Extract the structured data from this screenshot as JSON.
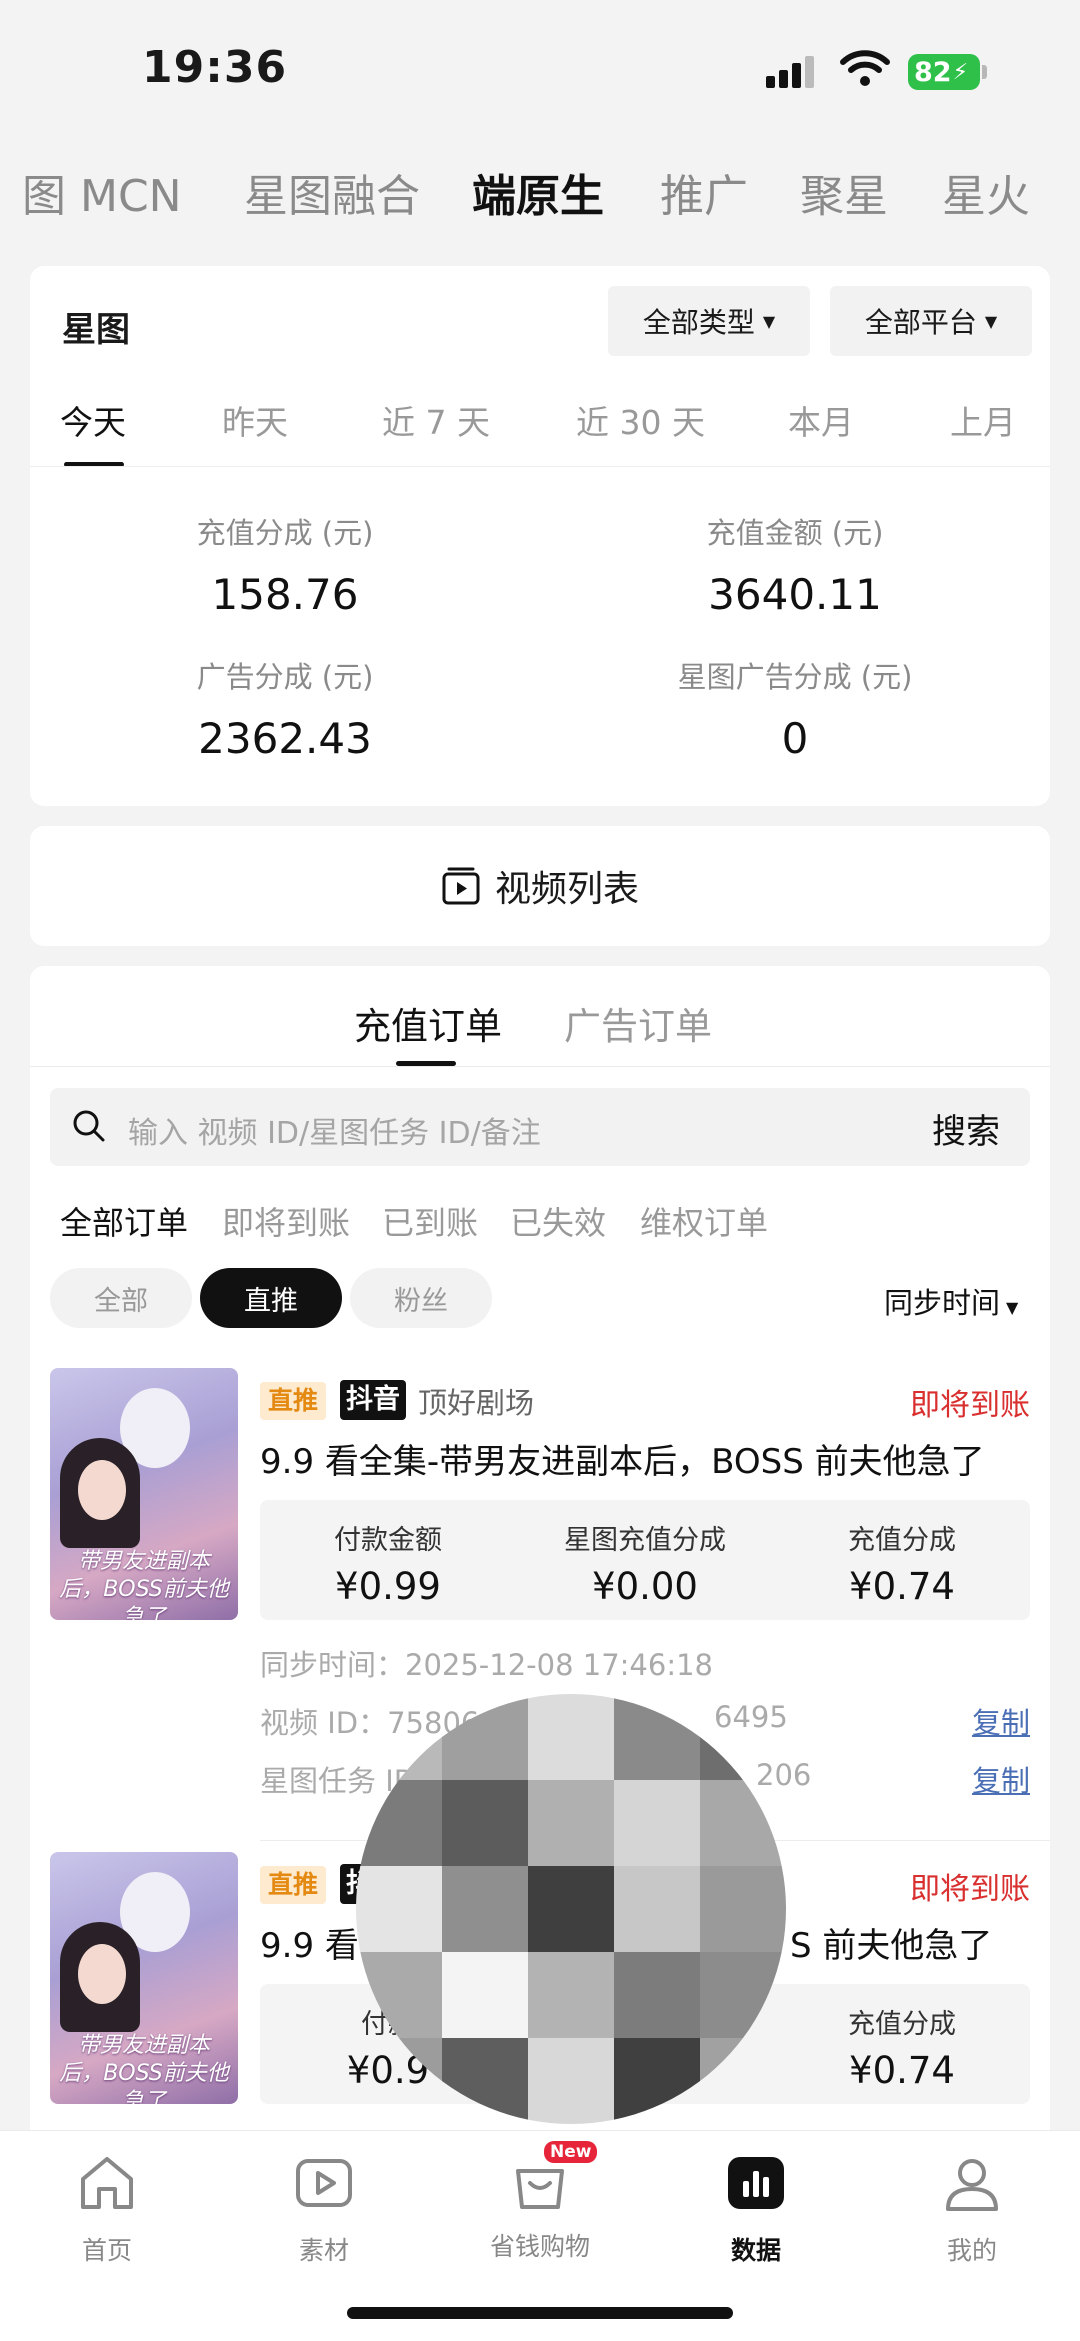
{
  "status_bar": {
    "time": "19:36",
    "battery": "82"
  },
  "category_tabs": [
    "图 MCN",
    "星图融合",
    "端原生",
    "推广",
    "聚星",
    "星火"
  ],
  "stats": {
    "title": "星图",
    "type_filter": "全部类型",
    "platform_filter": "全部平台",
    "date_tabs": [
      "今天",
      "昨天",
      "近 7 天",
      "近 30 天",
      "本月",
      "上月"
    ],
    "metrics": [
      {
        "label": "充值分成 (元)",
        "value": "158.76"
      },
      {
        "label": "充值金额 (元)",
        "value": "3640.11"
      },
      {
        "label": "广告分成 (元)",
        "value": "2362.43"
      },
      {
        "label": "星图广告分成 (元)",
        "value": "0"
      }
    ]
  },
  "video_list": {
    "label": "视频列表"
  },
  "orders": {
    "tab_recharge": "充值订单",
    "tab_ads": "广告订单",
    "search_placeholder": "输入 视频 ID/星图任务 ID/备注",
    "search_button": "搜索",
    "status_filters": [
      "全部订单",
      "即将到账",
      "已到账",
      "已失效",
      "维权订单"
    ],
    "chips": [
      "全部",
      "直推",
      "粉丝"
    ],
    "sort_label": "同步时间",
    "items": [
      {
        "tag": "直推",
        "platform": "抖音",
        "channel": "顶好剧场",
        "state": "即将到账",
        "title": "9.9 看全集-带男友进副本后，BOSS 前夫他急了",
        "thumb_text": "带男友进副本后，BOSS前夫他急了",
        "amounts": [
          {
            "label": "付款金额",
            "value": "¥0.99"
          },
          {
            "label": "星图充值分成",
            "value": "¥0.00"
          },
          {
            "label": "充值分成",
            "value": "¥0.74"
          }
        ],
        "sync_time": "同步时间：2025-12-08 17:46:18",
        "video_id": "视频 ID：75806",
        "video_id_tail": "6495",
        "task_id": "星图任务 ID",
        "task_id_tail": "206",
        "copy": "复制"
      },
      {
        "tag": "直推",
        "platform": "抖音",
        "state": "即将到账",
        "title_left": "9.9 看",
        "title_right": "S 前夫他急了",
        "thumb_text": "带男友进副本后，BOSS前夫他急了",
        "amounts": [
          {
            "label": "付款",
            "value": "¥0.9"
          },
          {
            "label": "",
            "value": ""
          },
          {
            "label": "充值分成",
            "value": "¥0.74"
          }
        ]
      }
    ]
  },
  "bottom_nav": [
    {
      "label": "首页",
      "icon": "home-icon"
    },
    {
      "label": "素材",
      "icon": "play-icon"
    },
    {
      "label": "省钱购物",
      "icon": "bag-icon",
      "badge": "New"
    },
    {
      "label": "数据",
      "icon": "chart-icon"
    },
    {
      "label": "我的",
      "icon": "user-icon"
    }
  ],
  "mosaic_colors": [
    "#b9b9b9",
    "#9f9f9f",
    "#dcdcdc",
    "#8a8a8a",
    "#6e6e6e",
    "#7b7b7b",
    "#5c5c5c",
    "#b0b0b0",
    "#d5d5d5",
    "#a8a8a8",
    "#e4e4e4",
    "#8f8f8f",
    "#3f3f3f",
    "#c7c7c7",
    "#9a9a9a",
    "#aaaaaa",
    "#f4f4f4",
    "#b3b3b3",
    "#7c7c7c",
    "#8c8c8c",
    "#9c9c9c",
    "#5e5e5e",
    "#d8d8d8",
    "#404040",
    "#a1a1a1"
  ]
}
